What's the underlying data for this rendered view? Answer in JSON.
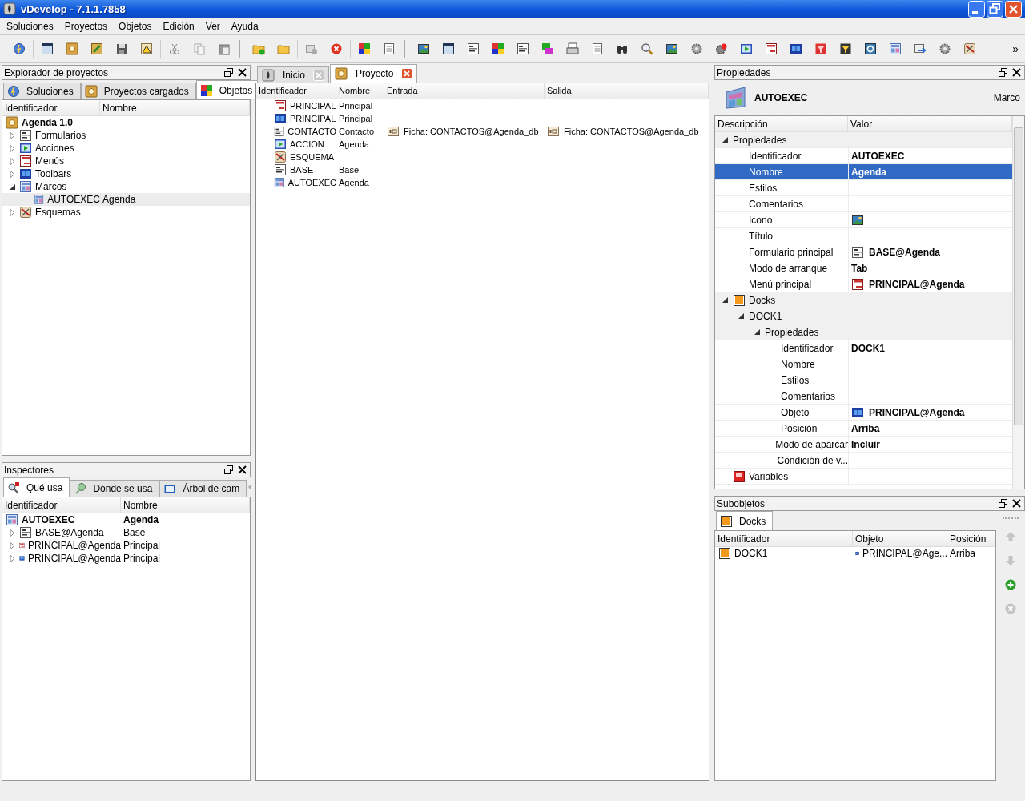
{
  "window": {
    "title": "vDevelop - 7.1.1.7858"
  },
  "menu": [
    "Soluciones",
    "Proyectos",
    "Objetos",
    "Edición",
    "Ver",
    "Ayuda"
  ],
  "toolbar": {
    "overflow": "»"
  },
  "project_explorer": {
    "title": "Explorador de proyectos",
    "tabs": [
      {
        "label": "Soluciones",
        "kind": "globe",
        "selected": false
      },
      {
        "label": "Proyectos cargados",
        "kind": "project",
        "selected": false
      },
      {
        "label": "Objetos",
        "kind": "objects",
        "selected": true
      }
    ],
    "columns": [
      "Identificador",
      "Nombre"
    ],
    "tree": [
      {
        "label": "Agenda 1.0",
        "kind": "project",
        "selected": false,
        "children": [
          {
            "label": "Formularios",
            "kind": "form",
            "expanded": false,
            "selected": false
          },
          {
            "label": "Acciones",
            "kind": "action",
            "expanded": false,
            "selected": false
          },
          {
            "label": "Menús",
            "kind": "menu",
            "expanded": false,
            "selected": false
          },
          {
            "label": "Toolbars",
            "kind": "toolbar",
            "expanded": false,
            "selected": false
          },
          {
            "label": "Marcos",
            "kind": "frame",
            "expanded": true,
            "selected": false,
            "children": [
              {
                "label": "AUTOEXEC",
                "name": "Agenda",
                "kind": "frame",
                "selected": true
              }
            ]
          },
          {
            "label": "Esquemas",
            "kind": "schema",
            "expanded": false,
            "selected": false
          }
        ]
      }
    ]
  },
  "inspectors": {
    "title": "Inspectores",
    "tabs": [
      {
        "label": "Qué usa",
        "kind": "uses",
        "selected": true
      },
      {
        "label": "Dónde se usa",
        "kind": "whereused",
        "selected": false
      },
      {
        "label": "Árbol de cam",
        "kind": "tree",
        "selected": false
      }
    ],
    "columns": [
      "Identificador",
      "Nombre"
    ],
    "tree": [
      {
        "label": "AUTOEXEC",
        "name": "Agenda",
        "kind": "frame",
        "children": [
          {
            "label": "BASE@Agenda",
            "name": "Base",
            "kind": "form",
            "expanded": false
          },
          {
            "label": "PRINCIPAL@Agenda",
            "name": "Principal",
            "kind": "menu",
            "expanded": false
          },
          {
            "label": "PRINCIPAL@Agenda",
            "name": "Principal",
            "kind": "toolbar",
            "expanded": false
          }
        ]
      }
    ]
  },
  "editor": {
    "tabs": [
      {
        "label": "Inicio",
        "kind": "home",
        "selected": false
      },
      {
        "label": "Proyecto",
        "kind": "project",
        "selected": true
      }
    ],
    "columns": [
      "Identificador",
      "Nombre",
      "Entrada",
      "Salida"
    ],
    "rows": [
      {
        "id": "PRINCIPAL",
        "name": "Principal",
        "kind": "menu"
      },
      {
        "id": "PRINCIPAL",
        "name": "Principal",
        "kind": "toolbar"
      },
      {
        "id": "CONTACTO",
        "name": "Contacto",
        "kind": "form",
        "input": "Ficha: CONTACTOS@Agenda_db",
        "output": "Ficha: CONTACTOS@Agenda_db"
      },
      {
        "id": "ACCION",
        "name": "Agenda",
        "kind": "action"
      },
      {
        "id": "ESQUEMA",
        "kind": "schema"
      },
      {
        "id": "BASE",
        "name": "Base",
        "kind": "form"
      },
      {
        "id": "AUTOEXEC",
        "name": "Agenda",
        "kind": "frame"
      }
    ]
  },
  "properties": {
    "title": "Propiedades",
    "object_id": "AUTOEXEC",
    "object_type": "Marco",
    "columns": [
      "Descripción",
      "Valor"
    ],
    "rows": [
      {
        "label": "Propiedades",
        "expanded": true,
        "selected": false,
        "children": [
          {
            "label": "Identificador",
            "value": "AUTOEXEC",
            "selected": false
          },
          {
            "label": "Nombre",
            "value": "Agenda",
            "selected": true
          },
          {
            "label": "Estilos",
            "selected": false
          },
          {
            "label": "Comentarios",
            "selected": false
          },
          {
            "label": "Icono",
            "value": {
              "kind": "image"
            },
            "selected": false
          },
          {
            "label": "Título",
            "selected": false
          },
          {
            "label": "Formulario principal",
            "value": {
              "kind": "form",
              "text": "BASE@Agenda"
            },
            "selected": false
          },
          {
            "label": "Modo de arranque",
            "value": "Tab",
            "selected": false
          },
          {
            "label": "Menú principal",
            "value": {
              "kind": "menu",
              "text": "PRINCIPAL@Agenda"
            },
            "selected": false
          }
        ]
      },
      {
        "label": "Docks",
        "kind": "dock",
        "expanded": true,
        "selected": false,
        "children": [
          {
            "label": "DOCK1",
            "expanded": true,
            "selected": false,
            "children": [
              {
                "label": "Propiedades",
                "expanded": true,
                "selected": false,
                "children": [
                  {
                    "label": "Identificador",
                    "value": "DOCK1",
                    "selected": false
                  },
                  {
                    "label": "Nombre",
                    "selected": false
                  },
                  {
                    "label": "Estilos",
                    "selected": false
                  },
                  {
                    "label": "Comentarios",
                    "selected": false
                  },
                  {
                    "label": "Objeto",
                    "value": {
                      "kind": "toolbar",
                      "text": "PRINCIPAL@Agenda"
                    },
                    "selected": false
                  },
                  {
                    "label": "Posición",
                    "value": "Arriba",
                    "selected": false
                  },
                  {
                    "label": "Modo de aparcar",
                    "value": "Incluir",
                    "selected": false
                  },
                  {
                    "label": "Condición de v...",
                    "selected": false
                  }
                ]
              }
            ]
          }
        ]
      },
      {
        "label": "Variables",
        "kind": "variables",
        "selected": false
      }
    ]
  },
  "subobjects": {
    "title": "Subobjetos",
    "tabs": [
      {
        "label": "Docks",
        "kind": "dock",
        "selected": true
      }
    ],
    "columns": [
      "Identificador",
      "Objeto",
      "Posición"
    ],
    "rows": [
      {
        "id": "DOCK1",
        "kind": "dock",
        "object": {
          "kind": "toolbar",
          "text": "PRINCIPAL@Age..."
        },
        "position": "Arriba"
      }
    ],
    "side_buttons": [
      {
        "kind": "up",
        "disabled": true
      },
      {
        "kind": "down",
        "disabled": true
      },
      {
        "kind": "add",
        "disabled": false
      },
      {
        "kind": "remove",
        "disabled": true
      }
    ]
  }
}
